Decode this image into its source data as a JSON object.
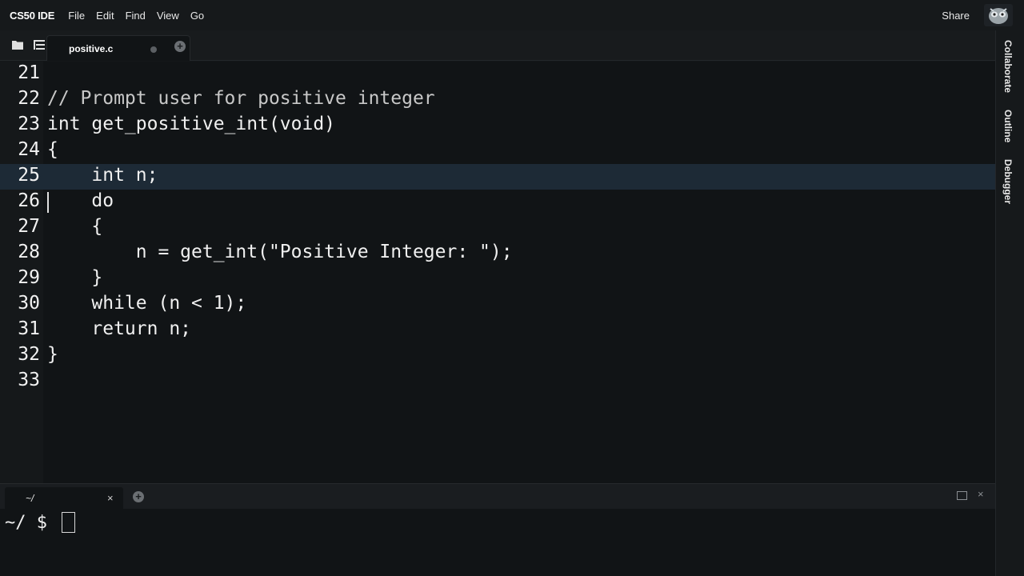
{
  "menubar": {
    "brand": "CS50 IDE",
    "items": [
      "File",
      "Edit",
      "Find",
      "View",
      "Go"
    ],
    "share": "Share"
  },
  "tabbar": {
    "icons": [
      "folder-icon",
      "tree-icon"
    ],
    "tab_label": "positive.c",
    "add_label": "+"
  },
  "editor": {
    "active_line": 25,
    "cursor_line": 26,
    "lines": [
      {
        "num": "21",
        "text": ""
      },
      {
        "num": "22",
        "text": "// Prompt user for positive integer"
      },
      {
        "num": "23",
        "text": "int get_positive_int(void)"
      },
      {
        "num": "24",
        "text": "{"
      },
      {
        "num": "25",
        "text": "    int n;"
      },
      {
        "num": "26",
        "text": "    do"
      },
      {
        "num": "27",
        "text": "    {"
      },
      {
        "num": "28",
        "text": "        n = get_int(\"Positive Integer: \");"
      },
      {
        "num": "29",
        "text": "    }"
      },
      {
        "num": "30",
        "text": "    while (n < 1);"
      },
      {
        "num": "31",
        "text": "    return n;"
      },
      {
        "num": "32",
        "text": "}"
      },
      {
        "num": "33",
        "text": ""
      }
    ]
  },
  "sidepanel": {
    "tabs": [
      "Collaborate",
      "Outline",
      "Debugger"
    ]
  },
  "terminal": {
    "tab_label": "~/",
    "close_label": "×",
    "add_label": "+",
    "close_panel_label": "×",
    "prompt": "~/ $"
  }
}
